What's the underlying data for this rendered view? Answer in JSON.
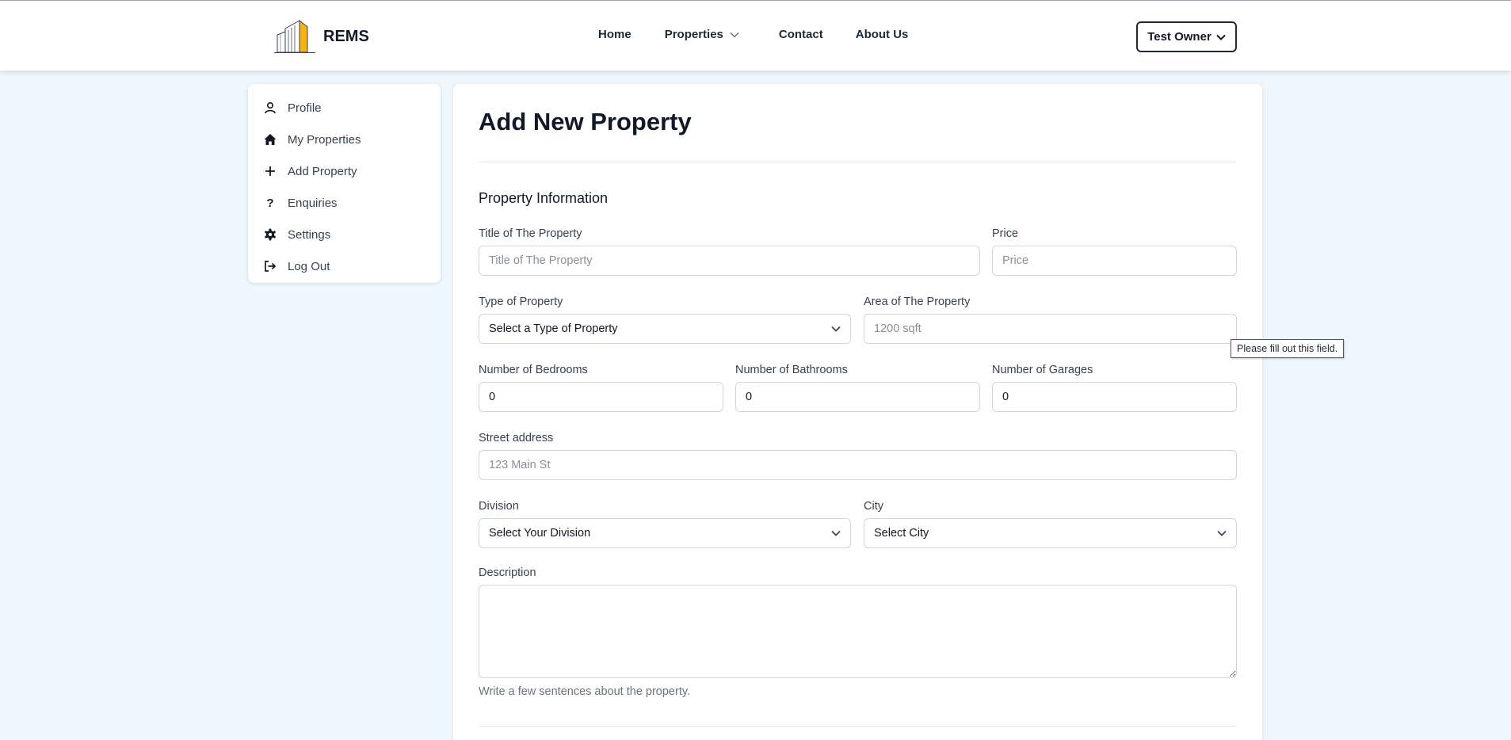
{
  "header": {
    "brand": "REMS",
    "nav": {
      "home": "Home",
      "properties": "Properties",
      "contact": "Contact",
      "about": "About Us"
    },
    "user_menu": "Test Owner"
  },
  "sidebar": {
    "items": [
      {
        "label": "Profile",
        "icon": "user-icon"
      },
      {
        "label": "My Properties",
        "icon": "home-icon"
      },
      {
        "label": "Add Property",
        "icon": "plus-icon"
      },
      {
        "label": "Enquiries",
        "icon": "question-icon"
      },
      {
        "label": "Settings",
        "icon": "gear-icon"
      },
      {
        "label": "Log Out",
        "icon": "logout-icon"
      }
    ]
  },
  "form": {
    "page_title": "Add New Property",
    "section_title": "Property Information",
    "title_field": {
      "label": "Title of The Property",
      "placeholder": "Title of The Property",
      "value": ""
    },
    "price_field": {
      "label": "Price",
      "placeholder": "Price",
      "value": ""
    },
    "type_field": {
      "label": "Type of Property",
      "selected": "Select a Type of Property"
    },
    "area_field": {
      "label": "Area of The Property",
      "placeholder": "1200 sqft",
      "value": ""
    },
    "bedrooms_field": {
      "label": "Number of Bedrooms",
      "value": "0"
    },
    "bathrooms_field": {
      "label": "Number of Bathrooms",
      "value": "0"
    },
    "garages_field": {
      "label": "Number of Garages",
      "value": "0"
    },
    "street_field": {
      "label": "Street address",
      "placeholder": "123 Main St",
      "value": ""
    },
    "division_field": {
      "label": "Division",
      "selected": "Select Your Division"
    },
    "city_field": {
      "label": "City",
      "selected": "Select City"
    },
    "description_field": {
      "label": "Description",
      "value": "",
      "hint": "Write a few sentences about the property."
    }
  },
  "validation_tooltip": "Please fill out this field.",
  "colors": {
    "background": "#eef6fe",
    "card": "#ffffff",
    "logo_accent": "#f5b316",
    "text": "#111827"
  }
}
